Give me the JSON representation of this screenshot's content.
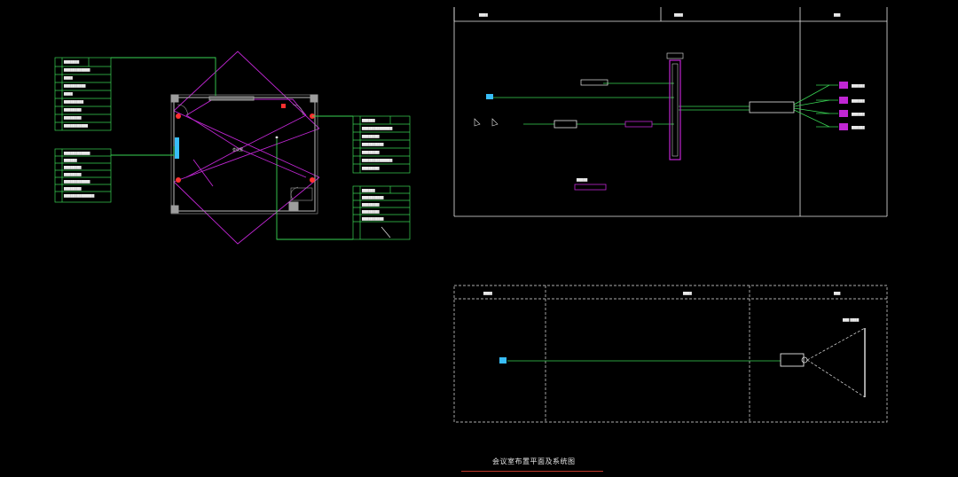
{
  "drawing": {
    "title": "会议室布置平面及系统图",
    "floor_plan": {
      "room_label": "会议室",
      "legend_top_left": {
        "header": [
          "",
          ""
        ],
        "rows": [
          "",
          "",
          "",
          "",
          "",
          ""
        ]
      }
    },
    "system_diagram_top": {
      "zones": [
        "",
        "",
        ""
      ]
    },
    "system_diagram_bottom": {
      "zones": [
        "",
        "",
        ""
      ],
      "screen_label": ""
    }
  },
  "colors": {
    "background": "#000000",
    "wire_green": "#39d353",
    "room_magenta": "#c026d3",
    "wall_grey": "#9e9e9e",
    "frame_white": "#e6e6e6",
    "accent_red": "#ff3030",
    "device_cyan": "#38bdf8",
    "title_underline": "#c0392b"
  }
}
